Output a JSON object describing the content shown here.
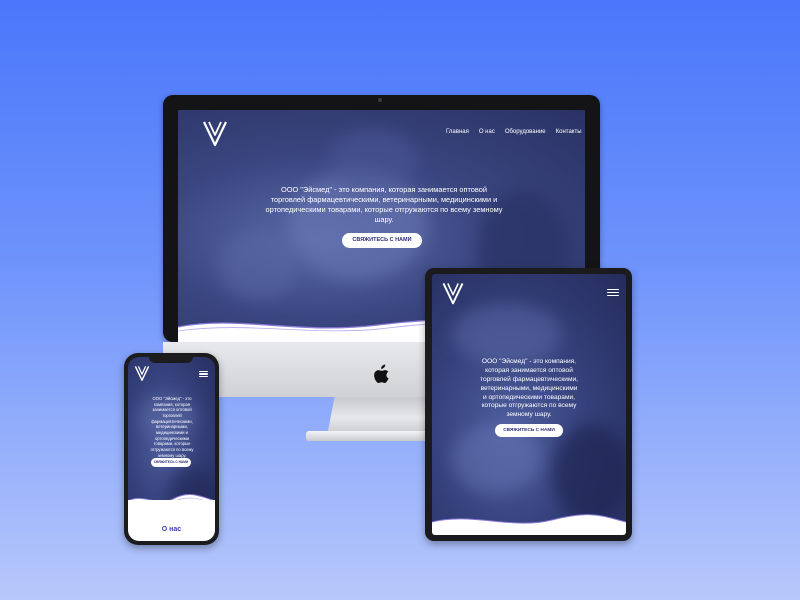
{
  "site": {
    "nav": [
      "Главная",
      "О нас",
      "Оборудование",
      "Контакты"
    ],
    "hero_text": "ООО \"Эйсмед\" - это компания, которая занимается оптовой торговлей фармацевтическими, ветеринарными, медицинскими и ортопедическими товарами, которые отгружаются по всему земному шару.",
    "cta_label": "СВЯЖИТЕСЬ С НАМИ",
    "about_heading": "О нас"
  },
  "colors": {
    "background_top": "#4a77fb",
    "background_bottom": "#b7c8fb",
    "hero_overlay": "#34407a",
    "cta_text": "#2c2c7a",
    "accent_wave": "#8a7bd8"
  },
  "icons": {
    "logo": "v-shaped-logo-icon",
    "menu": "hamburger-menu-icon",
    "apple": "apple-logo-icon"
  }
}
